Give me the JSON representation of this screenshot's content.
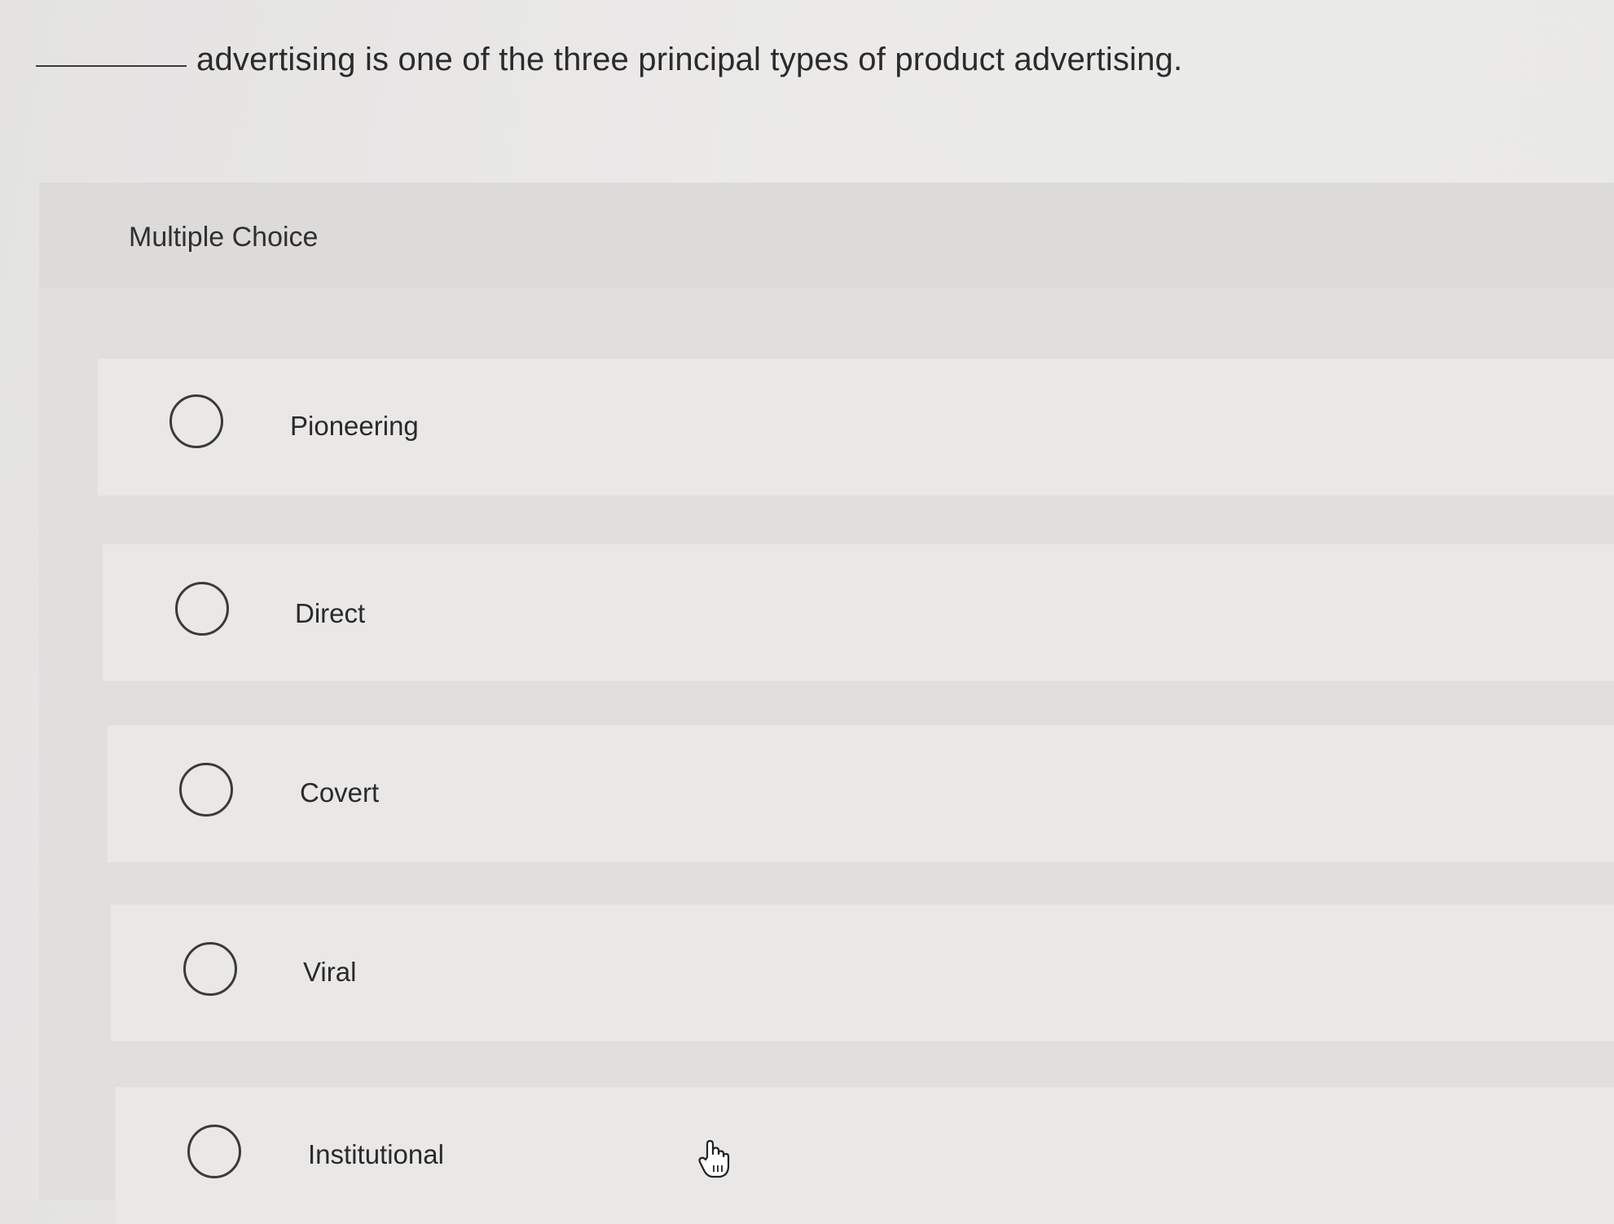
{
  "question": {
    "text": "advertising is one of the three principal types of product advertising."
  },
  "multiple_choice": {
    "title": "Multiple Choice",
    "options": [
      {
        "label": "Pioneering"
      },
      {
        "label": "Direct"
      },
      {
        "label": "Covert"
      },
      {
        "label": "Viral"
      },
      {
        "label": "Institutional"
      }
    ]
  },
  "icons": {
    "radio": "radio-button-icon",
    "cursor": "hand-pointer-cursor-icon"
  },
  "colors": {
    "page_background": "#e9e9e8",
    "panel_background": "#e0dfde",
    "option_background": "#e9e8e7",
    "text": "#2b2b2b"
  }
}
